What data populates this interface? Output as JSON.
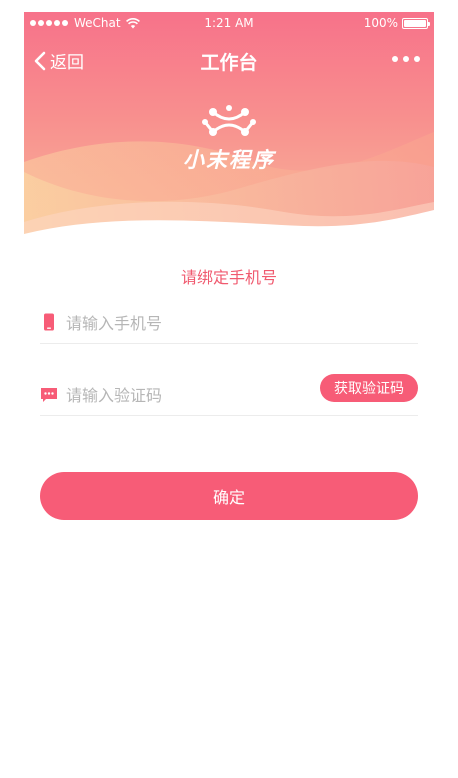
{
  "status_bar": {
    "carrier": "WeChat",
    "time": "1:21 AM",
    "battery": "100%",
    "battery_level": 1.0
  },
  "nav": {
    "back_label": "返回",
    "title": "工作台",
    "back_icon": "chevron-left-icon",
    "more_icon": "more-dots-icon"
  },
  "logo": {
    "text": "小末程序",
    "icon": "molecule-logo-icon"
  },
  "form": {
    "title": "请绑定手机号",
    "phone": {
      "placeholder": "请输入手机号",
      "value": "",
      "icon": "phone-icon"
    },
    "code": {
      "placeholder": "请输入验证码",
      "value": "",
      "icon": "message-icon",
      "button_label": "获取验证码"
    },
    "confirm_label": "确定"
  },
  "colors": {
    "accent": "#f75c77",
    "title": "#f05a6f",
    "header_top": "#f7728a",
    "header_bottom": "#f9c79a"
  }
}
